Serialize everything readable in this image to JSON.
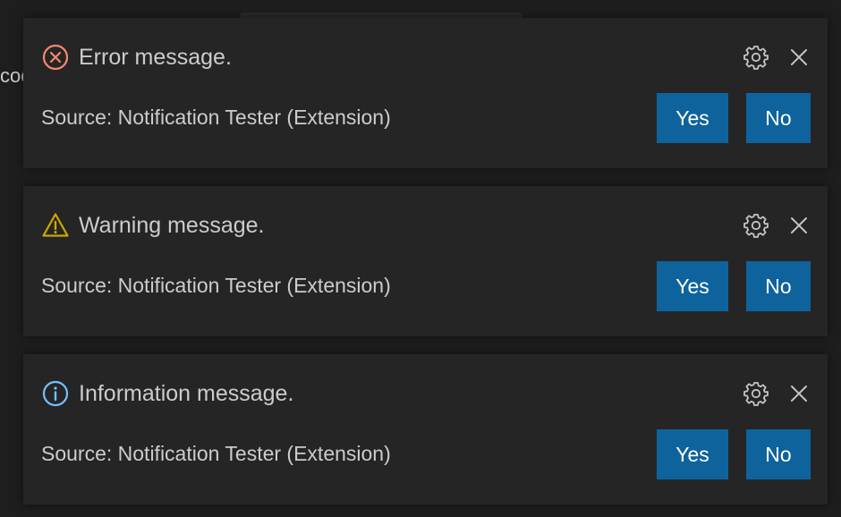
{
  "background": {
    "partial_text": "coc"
  },
  "notifications": [
    {
      "severity": "error",
      "icon": "error-icon",
      "icon_color": "#f48771",
      "message": "Error message.",
      "source": "Source: Notification Tester (Extension)",
      "settings_icon": "gear-icon",
      "close_icon": "close-icon",
      "buttons": {
        "yes": "Yes",
        "no": "No"
      }
    },
    {
      "severity": "warning",
      "icon": "warning-icon",
      "icon_color": "#cca700",
      "message": "Warning message.",
      "source": "Source: Notification Tester (Extension)",
      "settings_icon": "gear-icon",
      "close_icon": "close-icon",
      "buttons": {
        "yes": "Yes",
        "no": "No"
      }
    },
    {
      "severity": "info",
      "icon": "info-icon",
      "icon_color": "#75beff",
      "message": "Information message.",
      "source": "Source: Notification Tester (Extension)",
      "settings_icon": "gear-icon",
      "close_icon": "close-icon",
      "buttons": {
        "yes": "Yes",
        "no": "No"
      }
    }
  ],
  "colors": {
    "toast_background": "#252526",
    "button_background": "#0e639c",
    "text": "#cccccc"
  }
}
